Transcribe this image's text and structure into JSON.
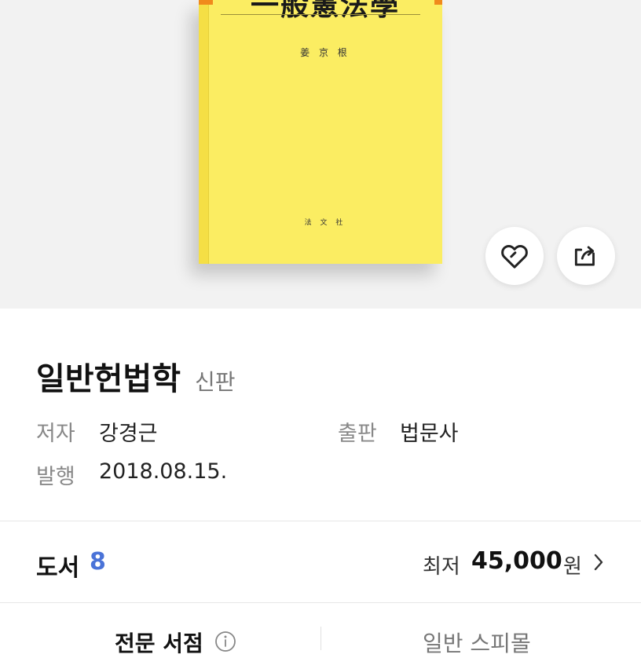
{
  "book_cover": {
    "title": "一般憲法學",
    "author": "姜 京 根",
    "publisher": "法 文 社"
  },
  "actions": {
    "like_icon": "heart-outline-icon",
    "share_icon": "share-icon"
  },
  "product": {
    "title": "일반헌법학",
    "edition": "신판",
    "author_label": "저자",
    "author": "강경근",
    "publisher_label": "출판",
    "publisher": "법문사",
    "date_label": "발행",
    "date": "2018.08.15."
  },
  "stock": {
    "label": "도서",
    "count": "8",
    "price_prefix": "최저",
    "price": "45,000",
    "price_unit": "원"
  },
  "tabs": {
    "new_store": "전문 서점",
    "used_store": "일반 스피몰"
  },
  "colors": {
    "accent": "#4a73d8",
    "cover": "#fbed62"
  }
}
